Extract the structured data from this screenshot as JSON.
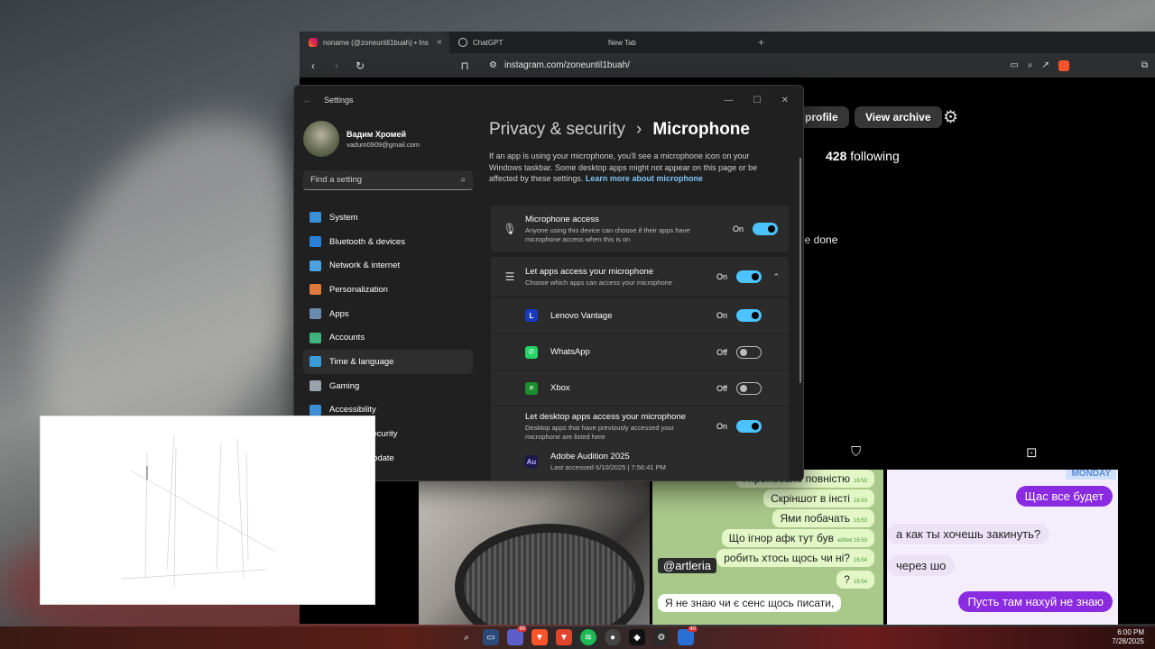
{
  "browser": {
    "tabs": [
      {
        "label": "noname (@zoneuntil1buah) • Ins",
        "active": true
      },
      {
        "label": "ChatGPT",
        "active": false
      },
      {
        "label": "New Tab",
        "active": false
      }
    ],
    "new_tab": "+",
    "url": "instagram.com/zoneuntil1buah/"
  },
  "instagram": {
    "edit_profile": "profile",
    "view_archive": "View archive",
    "following_count": "428",
    "following_label": "following",
    "bio_fragment": "be done",
    "chat1": [
      {
        "text": "І пройобано повністю",
        "time": "16:53"
      },
      {
        "text": "Скріншот в інсті",
        "time": "16:53"
      },
      {
        "text": "Ями побачать",
        "time": "16:53"
      },
      {
        "text": "Що ігнор афк тут був",
        "time": "edited 16:53"
      },
      {
        "text": "робить хтось щось чи ні?",
        "time": "16:54"
      },
      {
        "text": "?",
        "time": "16:54"
      },
      {
        "text": "Я не знаю чи є сенс щось писати,",
        "time": ""
      }
    ],
    "artleria": "@artleria",
    "chat2": {
      "tag": "MONDAY",
      "b1": "Щас все будет",
      "b2": "а как ты хочешь закинуть?",
      "b3": "через шо",
      "b4": "Пусть там нахуй не знаю"
    }
  },
  "settings": {
    "window_title": "Settings",
    "user": {
      "name": "Вадим Хромей",
      "email": "vadum0909@gmail.com"
    },
    "search_placeholder": "Find a setting",
    "nav": [
      {
        "label": "System",
        "color": "#3b8fd6"
      },
      {
        "label": "Bluetooth & devices",
        "color": "#2a7fd8"
      },
      {
        "label": "Network & internet",
        "color": "#4aa3e0"
      },
      {
        "label": "Personalization",
        "color": "#e07a3b"
      },
      {
        "label": "Apps",
        "color": "#6a8bb0"
      },
      {
        "label": "Accounts",
        "color": "#3fb37f"
      },
      {
        "label": "Time & language",
        "color": "#3a9bd8"
      },
      {
        "label": "Gaming",
        "color": "#9aa3ad"
      },
      {
        "label": "Accessibility",
        "color": "#3b8fd6"
      },
      {
        "label": "Privacy & security",
        "color": "#8a8a8a"
      },
      {
        "label": "Windows Update",
        "color": "#3b8fd6"
      }
    ],
    "breadcrumb_parent": "Privacy & security",
    "breadcrumb_sep": "›",
    "breadcrumb_current": "Microphone",
    "description": "If an app is using your microphone, you'll see a microphone icon on your Windows taskbar. Some desktop apps might not appear on this page or be affected by these settings.",
    "learn_more": "Learn more about microphone",
    "mic_access": {
      "title": "Microphone access",
      "sub": "Anyone using this device can choose if their apps have microphone access when this is on",
      "state": "On"
    },
    "let_apps": {
      "title": "Let apps access your microphone",
      "sub": "Choose which apps can access your microphone",
      "state": "On"
    },
    "apps": [
      {
        "name": "Lenovo Vantage",
        "badge": "L",
        "badge_color": "#1a3bbf",
        "state": "On"
      },
      {
        "name": "WhatsApp",
        "badge": "✆",
        "badge_color": "#25d366",
        "state": "Off"
      },
      {
        "name": "Xbox",
        "badge": "✕",
        "badge_color": "#1e8f2e",
        "state": "Off"
      }
    ],
    "desktop_apps": {
      "title": "Let desktop apps access your microphone",
      "sub": "Desktop apps that have previously accessed your microphone are listed here",
      "state": "On"
    },
    "adobe": {
      "name": "Adobe Audition 2025",
      "badge": "Au",
      "last": "Last accessed 6/10/2025  |  7:56:41 PM"
    }
  },
  "taskbar": {
    "time": "6:00 PM",
    "date": "7/28/2025",
    "badge_teams": "99",
    "badge_last": "40"
  }
}
